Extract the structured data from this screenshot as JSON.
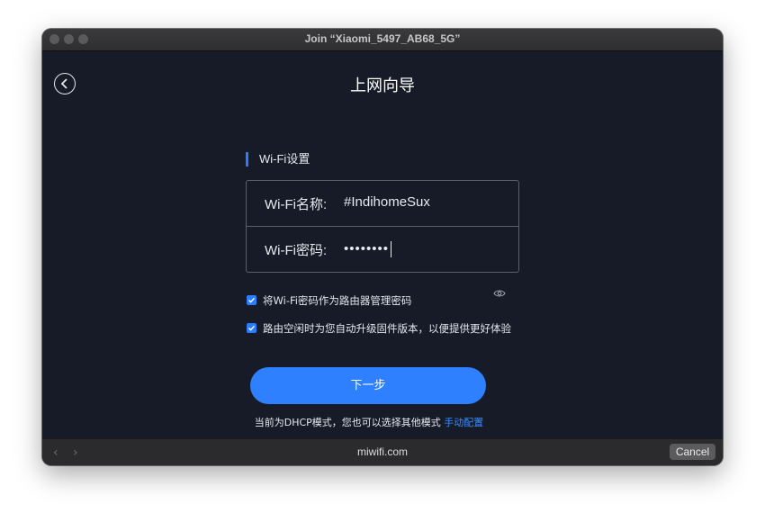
{
  "window": {
    "title": "Join “Xiaomi_5497_AB68_5G”"
  },
  "header": {
    "title": "上网向导",
    "back_icon": "chevron-left-circle-icon"
  },
  "section": {
    "title": "Wi-Fi设置"
  },
  "form": {
    "name_label": "Wi-Fi名称:",
    "name_value": "#IndihomeSux",
    "password_label": "Wi-Fi密码:",
    "password_value": "••••••••"
  },
  "options": [
    {
      "label": "将Wi-Fi密码作为路由器管理密码",
      "checked": true
    },
    {
      "label": "路由空闲时为您自动升级固件版本，以便提供更好体验",
      "checked": true
    }
  ],
  "eye_icon": "eye-icon",
  "next_button": "下一步",
  "note": {
    "text": "当前为DHCP模式，您也可以选择其他模式 ",
    "link": "手动配置"
  },
  "statusbar": {
    "url": "miwifi.com",
    "cancel": "Cancel"
  },
  "colors": {
    "accent": "#2f80ff",
    "background": "#161b27"
  }
}
